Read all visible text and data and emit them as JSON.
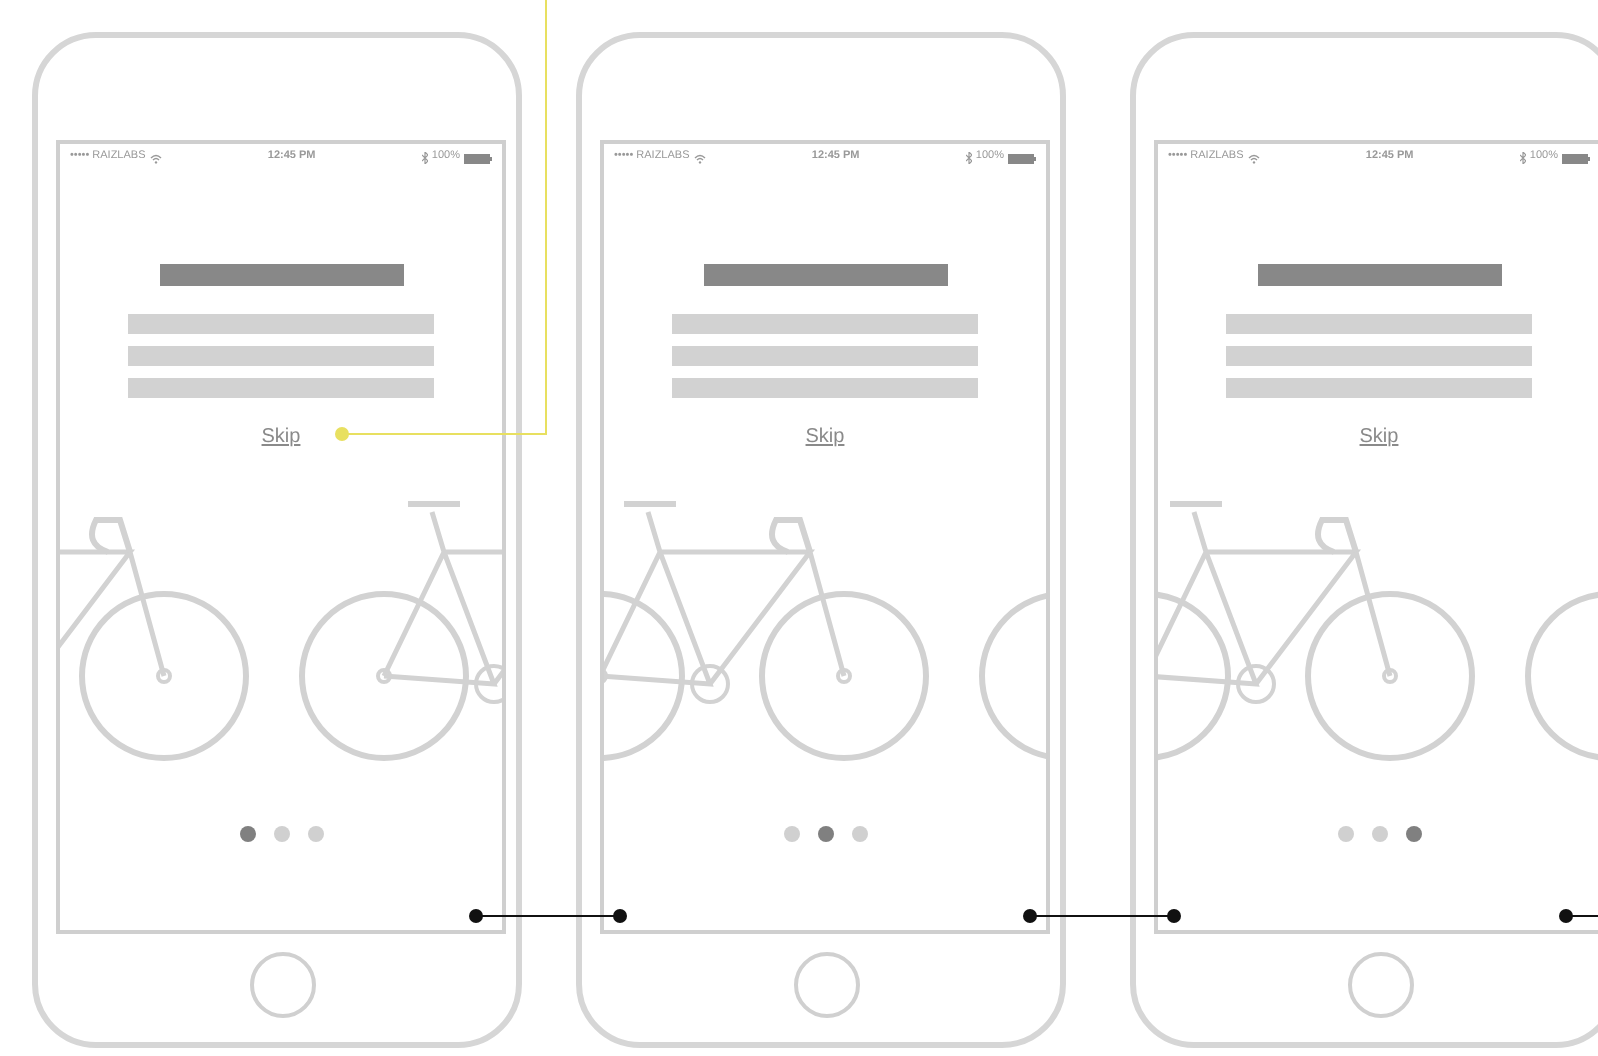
{
  "phones": [
    {
      "status": {
        "carrier": "••••• RAIZLABS",
        "time": "12:45 PM",
        "battery": "100%"
      },
      "skip": "Skip",
      "dots": [
        {
          "selected": true
        },
        {
          "selected": false
        },
        {
          "selected": false
        }
      ]
    },
    {
      "status": {
        "carrier": "••••• RAIZLABS",
        "time": "12:45 PM",
        "battery": "100%"
      },
      "skip": "Skip",
      "dots": [
        {
          "selected": false
        },
        {
          "selected": true
        },
        {
          "selected": false
        }
      ]
    },
    {
      "status": {
        "carrier": "••••• RAIZLABS",
        "time": "12:45 PM",
        "battery": "100%"
      },
      "skip": "Skip",
      "dots": [
        {
          "selected": false
        },
        {
          "selected": false
        },
        {
          "selected": true
        }
      ]
    }
  ]
}
